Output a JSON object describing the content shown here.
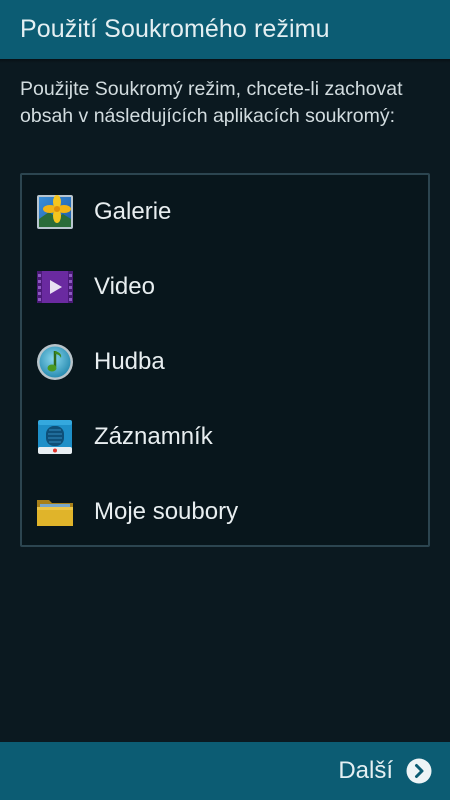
{
  "header": {
    "title": "Použití Soukromého režimu"
  },
  "description": "Použijte Soukromý režim, chcete-li zachovat obsah v následujících aplikacích soukromý:",
  "apps": [
    {
      "label": "Galerie",
      "icon": "gallery-icon"
    },
    {
      "label": "Video",
      "icon": "video-icon"
    },
    {
      "label": "Hudba",
      "icon": "music-icon"
    },
    {
      "label": "Záznamník",
      "icon": "voice-recorder-icon"
    },
    {
      "label": "Moje soubory",
      "icon": "folder-icon"
    }
  ],
  "footer": {
    "next_label": "Další",
    "next_icon": "chevron-right-circle-icon"
  },
  "colors": {
    "background": "#0b1920",
    "title_bar": "#0c5c73",
    "list_border": "#2c4550",
    "text": "#e8eef0"
  }
}
